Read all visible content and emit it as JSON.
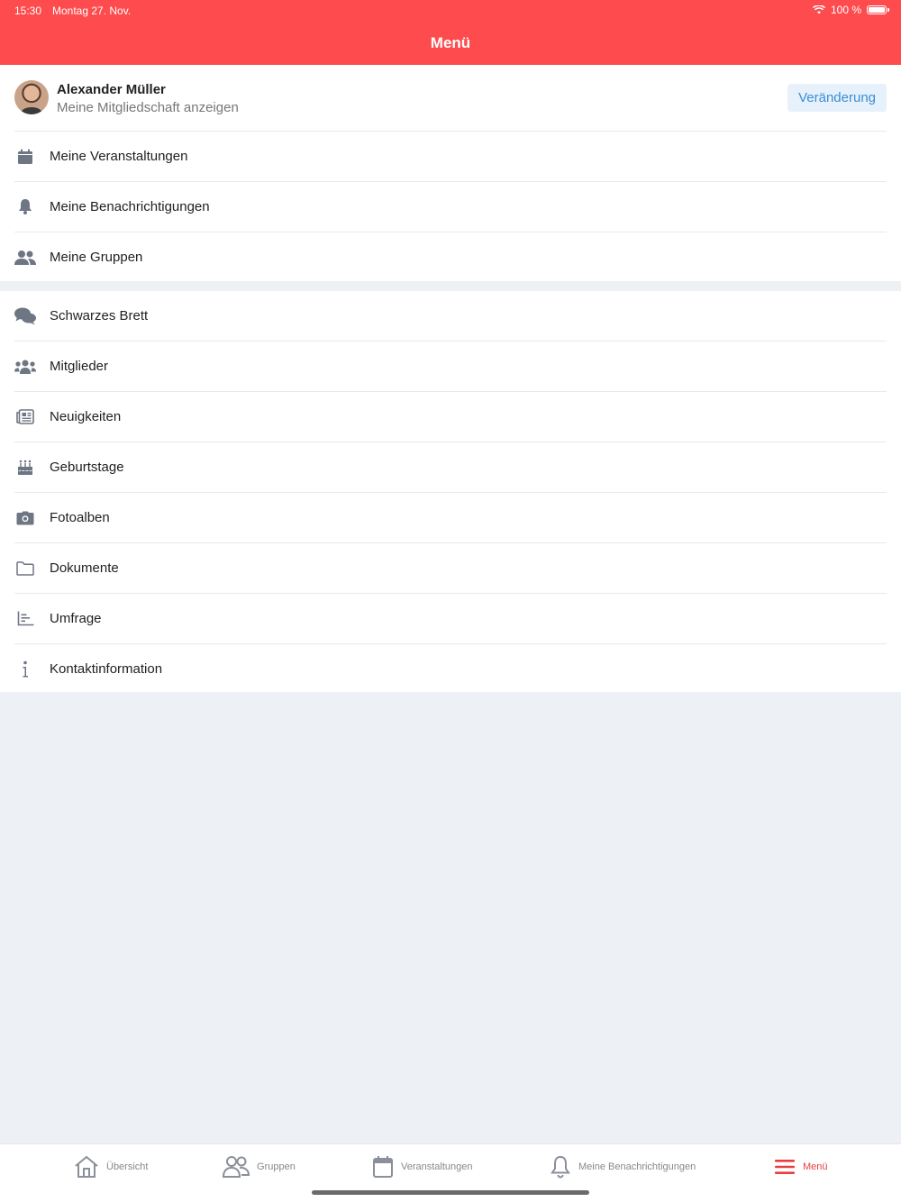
{
  "status": {
    "time": "15:30",
    "date": "Montag 27. Nov.",
    "battery": "100 %"
  },
  "header": {
    "title": "Menü"
  },
  "profile": {
    "name": "Alexander Müller",
    "subtitle": "Meine Mitgliedschaft anzeigen",
    "change_label": "Veränderung"
  },
  "menu_primary": [
    {
      "label": "Meine Veranstaltungen",
      "icon": "calendar-icon"
    },
    {
      "label": "Meine Benachrichtigungen",
      "icon": "bell-icon"
    },
    {
      "label": "Meine Gruppen",
      "icon": "users-icon"
    }
  ],
  "menu_secondary": [
    {
      "label": "Schwarzes Brett",
      "icon": "comments-icon"
    },
    {
      "label": "Mitglieder",
      "icon": "members-icon"
    },
    {
      "label": "Neuigkeiten",
      "icon": "newspaper-icon"
    },
    {
      "label": "Geburtstage",
      "icon": "birthday-cake-icon"
    },
    {
      "label": "Fotoalben",
      "icon": "camera-icon"
    },
    {
      "label": "Dokumente",
      "icon": "folder-icon"
    },
    {
      "label": "Umfrage",
      "icon": "poll-chart-icon"
    },
    {
      "label": "Kontaktinformation",
      "icon": "info-icon"
    }
  ],
  "tabbar": {
    "items": [
      {
        "label": "Übersicht",
        "icon": "home-icon"
      },
      {
        "label": "Gruppen",
        "icon": "group-icon"
      },
      {
        "label": "Veranstaltungen",
        "icon": "calendar-icon"
      },
      {
        "label": "Meine Benachrichtigungen",
        "icon": "bell-icon"
      },
      {
        "label": "Menü",
        "icon": "hamburger-menu-icon"
      }
    ],
    "active_color": "#e8403f"
  },
  "colors": {
    "header": "#fd4b4e",
    "accent": "#3b8dd6",
    "background": "#edf0f4"
  }
}
